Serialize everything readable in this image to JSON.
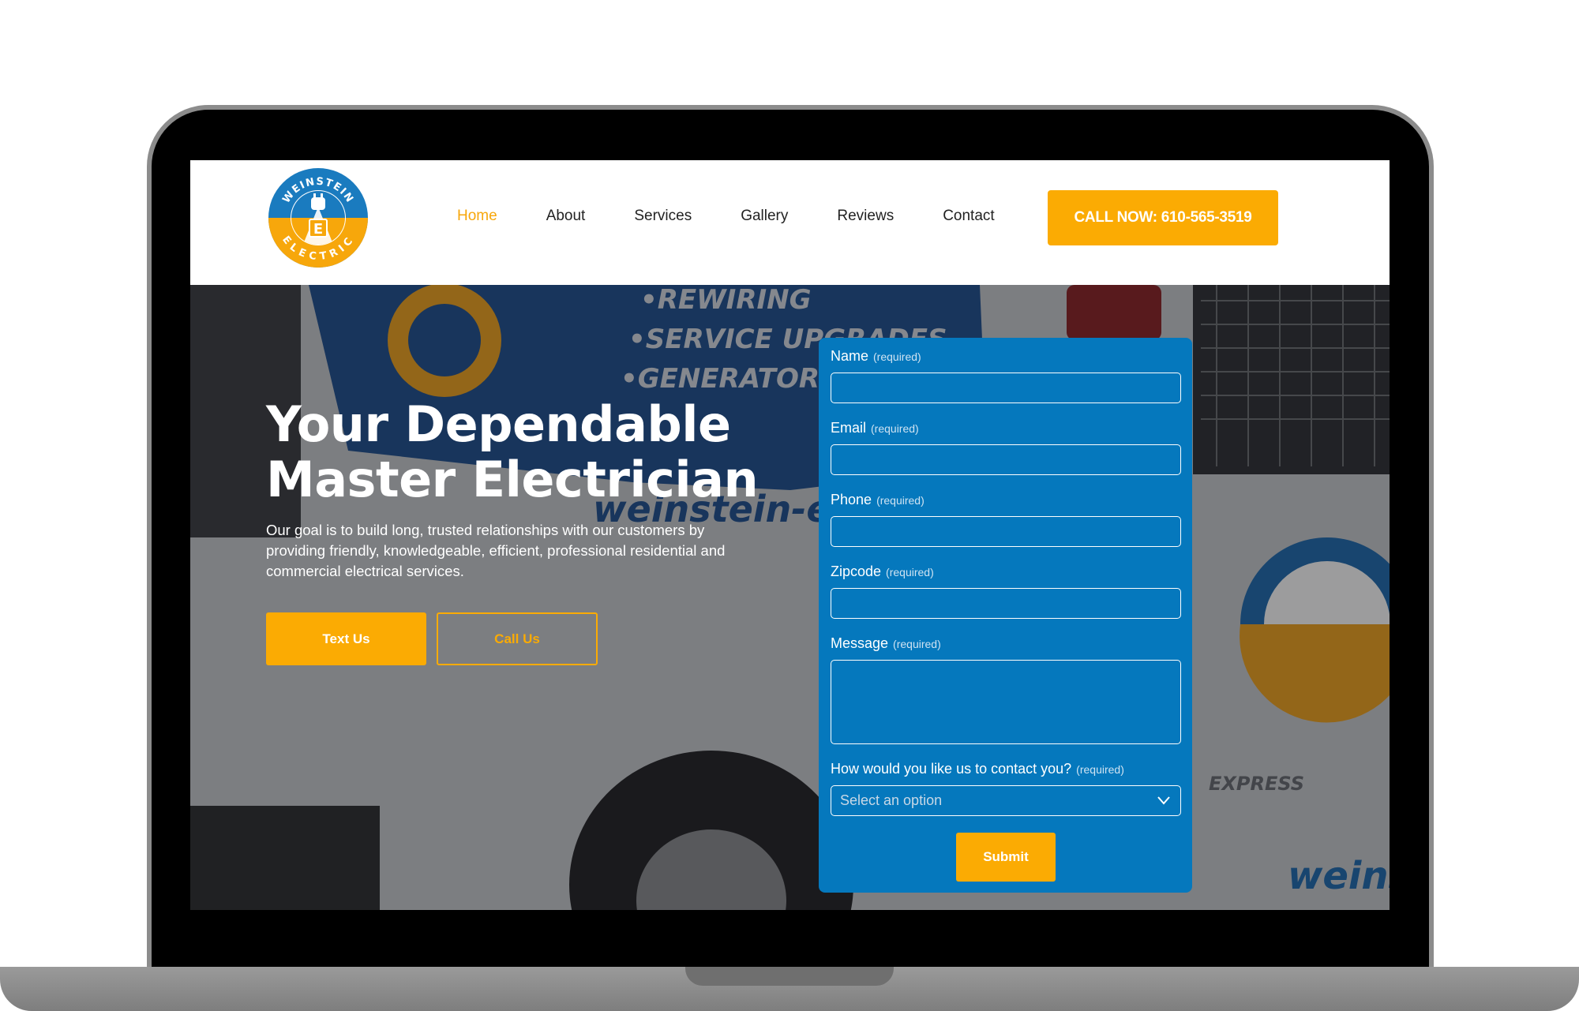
{
  "nav": {
    "items": [
      {
        "label": "Home",
        "active": true
      },
      {
        "label": "About",
        "active": false
      },
      {
        "label": "Services",
        "active": false
      },
      {
        "label": "Gallery",
        "active": false
      },
      {
        "label": "Reviews",
        "active": false
      },
      {
        "label": "Contact",
        "active": false
      }
    ],
    "call_label": "CALL NOW: 610-565-3519"
  },
  "logo": {
    "top_text": "WEINSTEIN",
    "bottom_text": "ELECTRIC",
    "letter": "E"
  },
  "hero": {
    "title_line1": "Your Dependable",
    "title_line2": "Master Electrician",
    "subtitle": "Our goal is to build long, trusted relationships with our customers by providing friendly, knowledgeable, efficient, professional residential and commercial electrical services.",
    "text_button": "Text Us",
    "call_button": "Call Us",
    "van_text_1": "•REWIRING",
    "van_text_2": "•SERVICE UPGRADES",
    "van_text_3": "•GENERATORS",
    "van_url": "weinstein-elect",
    "van_brand": "weins",
    "van_model": "EXPRESS"
  },
  "form": {
    "required_tag": "(required)",
    "name_label": "Name",
    "email_label": "Email",
    "phone_label": "Phone",
    "zipcode_label": "Zipcode",
    "message_label": "Message",
    "contact_label": "How would you like us to contact you?",
    "select_placeholder": "Select an option",
    "submit_label": "Submit"
  },
  "colors": {
    "accent": "#fbab03",
    "form_blue": "#0578bd",
    "nav_text": "#222222"
  }
}
